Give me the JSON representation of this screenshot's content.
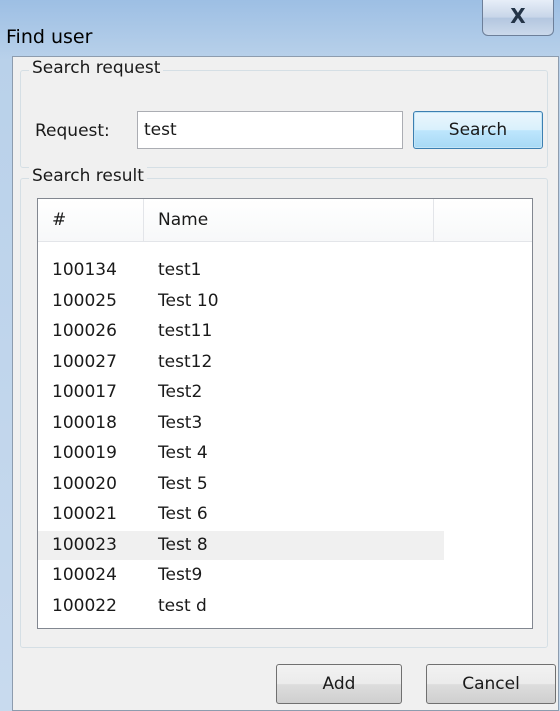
{
  "window": {
    "title": "Find user",
    "close_glyph": "X"
  },
  "search_group": {
    "legend": "Search request",
    "request_label": "Request:",
    "request_value": "test",
    "search_button": "Search"
  },
  "result_group": {
    "legend": "Search result",
    "columns": [
      "#",
      "Name",
      ""
    ],
    "rows": [
      {
        "id": "100134",
        "name": "test1"
      },
      {
        "id": "100025",
        "name": "Test 10"
      },
      {
        "id": "100026",
        "name": "test11"
      },
      {
        "id": "100027",
        "name": "test12"
      },
      {
        "id": "100017",
        "name": "Test2"
      },
      {
        "id": "100018",
        "name": "Test3"
      },
      {
        "id": "100019",
        "name": "Test 4"
      },
      {
        "id": "100020",
        "name": "Test 5"
      },
      {
        "id": "100021",
        "name": "Test 6"
      },
      {
        "id": "100023",
        "name": "Test 8",
        "selected": true
      },
      {
        "id": "100024",
        "name": "Test9"
      },
      {
        "id": "100022",
        "name": "test d"
      }
    ]
  },
  "buttons": {
    "add": "Add",
    "cancel": "Cancel"
  },
  "icons": {
    "close": "close-icon"
  }
}
